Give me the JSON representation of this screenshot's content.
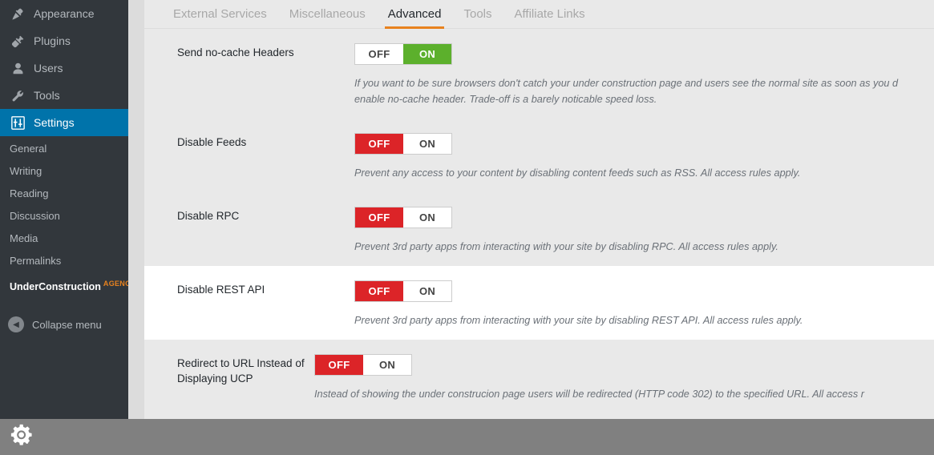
{
  "sidebar": {
    "menu": [
      {
        "label": "Appearance",
        "icon": "paintbrush-icon",
        "active": false
      },
      {
        "label": "Plugins",
        "icon": "plug-icon",
        "active": false
      },
      {
        "label": "Users",
        "icon": "user-icon",
        "active": false
      },
      {
        "label": "Tools",
        "icon": "wrench-icon",
        "active": false
      },
      {
        "label": "Settings",
        "icon": "sliders-icon",
        "active": true
      }
    ],
    "submenu": [
      {
        "label": "General"
      },
      {
        "label": "Writing"
      },
      {
        "label": "Reading"
      },
      {
        "label": "Discussion"
      },
      {
        "label": "Media"
      },
      {
        "label": "Permalinks"
      },
      {
        "label": "UnderConstruction",
        "badge": "AGENCY",
        "bold": true
      }
    ],
    "collapse_label": "Collapse menu",
    "active_color": "#0073aa",
    "background_color": "#32373c",
    "badge_color": "#e8821e"
  },
  "tabs": [
    {
      "label": "External Services",
      "active": false
    },
    {
      "label": "Miscellaneous",
      "active": false
    },
    {
      "label": "Advanced",
      "active": true
    },
    {
      "label": "Tools",
      "active": false
    },
    {
      "label": "Affiliate Links",
      "active": false
    }
  ],
  "tab_accent_color": "#e8821e",
  "toggle": {
    "off_label": "OFF",
    "on_label": "ON",
    "on_color": "#5cb02c",
    "off_color": "#dc2428"
  },
  "settings_rows": [
    {
      "label": "Send no-cache Headers",
      "state": "ON",
      "description": "If you want to be sure browsers don't catch your under construction page and users see the normal site as soon as you d",
      "description2": "enable no-cache header. Trade-off is a barely noticable speed loss.",
      "alt": false
    },
    {
      "label": "Disable Feeds",
      "state": "OFF",
      "description": "Prevent any access to your content by disabling content feeds such as RSS. All access rules apply.",
      "description2": "",
      "alt": false
    },
    {
      "label": "Disable RPC",
      "state": "OFF",
      "description": "Prevent 3rd party apps from interacting with your site by disabling RPC. All access rules apply.",
      "description2": "",
      "alt": false
    },
    {
      "label": "Disable REST API",
      "state": "OFF",
      "description": "Prevent 3rd party apps from interacting with your site by disabling REST API. All access rules apply.",
      "description2": "",
      "alt": true
    },
    {
      "label": "Redirect to URL Instead of Displaying UCP",
      "state": "OFF",
      "description": "Instead of showing the under construcion page users will be redirected (HTTP code 302) to the specified URL. All access r",
      "description2": "",
      "alt": false
    }
  ],
  "bottombar": {
    "icon": "gear-wrench-icon",
    "background_color": "#808080"
  }
}
